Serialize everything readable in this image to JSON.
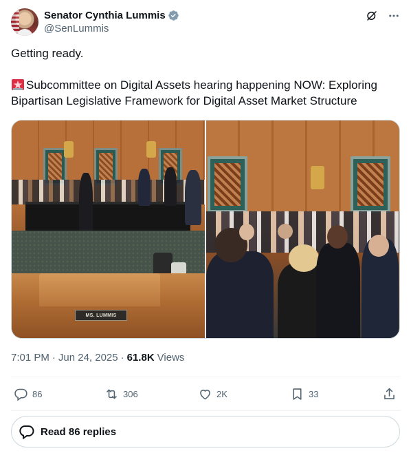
{
  "author": {
    "display_name": "Senator Cynthia Lummis",
    "handle": "@SenLummis",
    "verified": true
  },
  "header_icons": [
    "grok-icon",
    "more-icon"
  ],
  "post": {
    "line1": "Getting ready.",
    "line2": "Subcommittee on Digital Assets hearing happening NOW: Exploring Bipartisan Legislative Framework for Digital Asset Market Structure",
    "line2_prefix_icon": "siren-emoji-icon"
  },
  "media": {
    "nameplate": "MS. LUMMIS"
  },
  "meta": {
    "time": "7:01 PM",
    "date": "Jun 24, 2025",
    "separator": "·",
    "views_count": "61.8K",
    "views_label": "Views"
  },
  "actions": {
    "replies": "86",
    "reposts": "306",
    "likes": "2K",
    "bookmarks": "33"
  },
  "read_replies_label": "Read 86 replies",
  "colors": {
    "text": "#0f1419",
    "secondary": "#536471",
    "verified_badge": "#829aab",
    "border": "#cfd9de"
  }
}
